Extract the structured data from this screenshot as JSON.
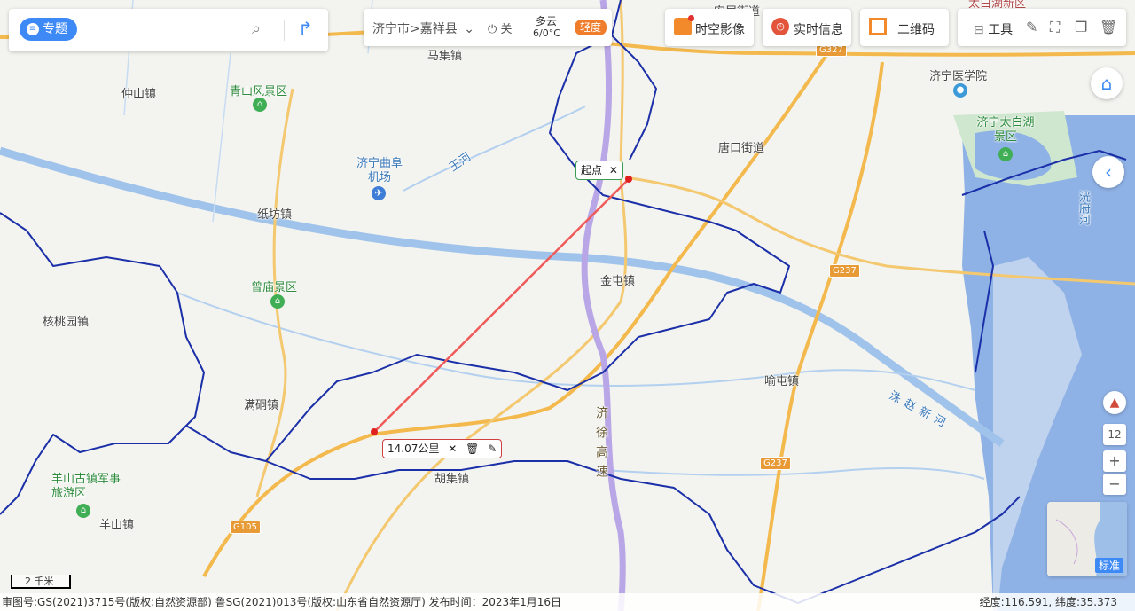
{
  "search": {
    "topic_label": "专题",
    "topic_icon": "list-icon",
    "search_icon": "search-icon",
    "route_icon": "route-arrow-icon"
  },
  "location": {
    "city": "济宁市",
    "separator": ">",
    "county": "嘉祥县"
  },
  "power": {
    "label": "关"
  },
  "weather": {
    "condition": "多云",
    "temp": "6/0°C",
    "aqi": "轻度",
    "aqi_color": "#ef7d2b"
  },
  "toolbar": {
    "spacetime": "时空影像",
    "realtime": "实时信息",
    "qrcode": "二维码",
    "tools": "工具"
  },
  "map_labels": {
    "towns": [
      "仲山镇",
      "纸坊镇",
      "核桃园镇",
      "满硐镇",
      "羊山镇",
      "马集镇",
      "唐口街道",
      "金屯镇",
      "喻屯镇",
      "胡集镇"
    ],
    "scenic": [
      "青山风景区",
      "曾庙景区",
      "羊山古镇军事旅游区",
      "济宁太白湖景区"
    ],
    "poi": [
      "济宁曲阜机场",
      "济宁医学院"
    ],
    "water": [
      "王河",
      "洙赵新河",
      "洸府河"
    ],
    "roads": [
      "济徐高速"
    ],
    "shields": [
      "G327",
      "G237",
      "G237",
      "G105"
    ],
    "top_cut": [
      "太白湖新区",
      "安居街道"
    ]
  },
  "measure": {
    "start_label": "起点",
    "distance": "14.07公里"
  },
  "zoom": {
    "level": "12",
    "plus": "+",
    "minus": "−"
  },
  "scale": {
    "label": "2 千米"
  },
  "minimap": {
    "label": "标准"
  },
  "footer": {
    "copyright": "审图号:GS(2021)3715号(版权:自然资源部) 鲁SG(2021)013号(版权:山东省自然资源厅) 发布时间：2023年1月16日",
    "coords": "经度:116.591, 纬度:35.373"
  },
  "colors": {
    "accent": "#3d8af7",
    "boundary": "#1a2fa8",
    "highway": "#b9a6e6",
    "national_road": "#f3b94d",
    "river": "#9fc3ea",
    "measure_line": "#ef5a5a"
  }
}
